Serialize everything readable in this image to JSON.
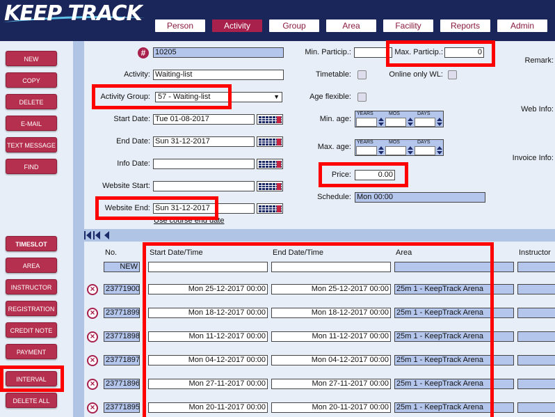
{
  "app": {
    "logo": "KEEP TRACK"
  },
  "nav": {
    "tabs": [
      {
        "label": "Person",
        "active": false
      },
      {
        "label": "Activity",
        "active": true
      },
      {
        "label": "Group",
        "active": false
      },
      {
        "label": "Area",
        "active": false
      },
      {
        "label": "Facility",
        "active": false
      },
      {
        "label": "Reports",
        "active": false
      },
      {
        "label": "Admin",
        "active": false
      }
    ]
  },
  "sidebar": {
    "top": [
      "NEW",
      "COPY",
      "DELETE",
      "E-MAIL",
      "TEXT MESSAGE",
      "FIND"
    ],
    "timeslot": [
      "TIMESLOT",
      "AREA",
      "INSTRUCTOR",
      "REGISTRATION",
      "CREDIT NOTE",
      "PAYMENT",
      "INTERVAL",
      "DELETE ALL"
    ]
  },
  "form": {
    "id_value": "10205",
    "activity_label": "Activity:",
    "activity_value": "Waiting-list",
    "group_label": "Activity Group:",
    "group_value": "57 - Waiting-list",
    "start_label": "Start Date:",
    "start_value": "Tue 01-08-2017",
    "end_label": "End Date:",
    "end_value": "Sun 31-12-2017",
    "info_label": "Info Date:",
    "info_value": "",
    "webstart_label": "Website Start:",
    "webstart_value": "",
    "webend_label": "Website End:",
    "webend_value": "Sun 31-12-2017",
    "use_course_end": "Use course end date",
    "min_partic_label": "Min. Particip.:",
    "min_partic_value": "",
    "max_partic_label": "Max. Particip.:",
    "max_partic_value": "0",
    "timetable_label": "Timetable:",
    "online_wl_label": "Online only WL:",
    "age_flexible_label": "Age flexible:",
    "min_age_label": "Min. age:",
    "max_age_label": "Max. age:",
    "age_caps": {
      "years": "YEARS",
      "mos": "MOS",
      "days": "DAYS"
    },
    "price_label": "Price:",
    "price_value": "0.00",
    "schedule_label": "Schedule:",
    "schedule_value": "Mon 00:00",
    "remark_label": "Remark:",
    "webinfo_label": "Web Info:",
    "invoice_label": "Invoice Info:"
  },
  "timeslots": {
    "headers": {
      "no": "No.",
      "start": "Start Date/Time",
      "end": "End Date/Time",
      "area": "Area",
      "instructor": "Instructor"
    },
    "new_label": "NEW",
    "rows": [
      {
        "no": "23771900",
        "start": "Mon 25-12-2017 00:00",
        "end": "Mon 25-12-2017 00:00",
        "area": "25m 1 - KeepTrack Arena"
      },
      {
        "no": "23771899",
        "start": "Mon 18-12-2017 00:00",
        "end": "Mon 18-12-2017 00:00",
        "area": "25m 1 - KeepTrack Arena"
      },
      {
        "no": "23771898",
        "start": "Mon 11-12-2017 00:00",
        "end": "Mon 11-12-2017 00:00",
        "area": "25m 1 - KeepTrack Arena"
      },
      {
        "no": "23771897",
        "start": "Mon 04-12-2017 00:00",
        "end": "Mon 04-12-2017 00:00",
        "area": "25m 1 - KeepTrack Arena"
      },
      {
        "no": "23771896",
        "start": "Mon 27-11-2017 00:00",
        "end": "Mon 27-11-2017 00:00",
        "area": "25m 1 - KeepTrack Arena"
      },
      {
        "no": "23771895",
        "start": "Mon 20-11-2017 00:00",
        "end": "Mon 20-11-2017 00:00",
        "area": "25m 1 - KeepTrack Arena"
      }
    ]
  },
  "colors": {
    "header": "#1a2559",
    "accent": "#a8204c",
    "highlight": "#ff0000",
    "readonly": "#b4c6ec"
  }
}
